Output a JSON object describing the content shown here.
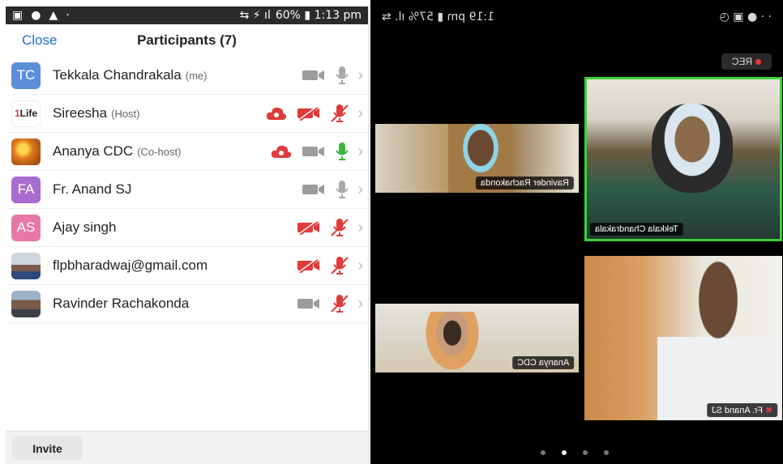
{
  "left_status": {
    "right_text": "60% ▮ 1:13 pm"
  },
  "header": {
    "close": "Close",
    "title": "Participants (7)"
  },
  "participants": [
    {
      "name": "Tekkala Chandrakala",
      "role": "(me)",
      "avatar": "TC",
      "avatar_color": "#5d8ed8"
    },
    {
      "name": "Sireesha",
      "role": "(Host)",
      "avatar": "1Life",
      "avatar_color": "#ffffff"
    },
    {
      "name": "Ananya CDC",
      "role": "(Co-host)",
      "avatar": "",
      "avatar_color": "#e07a1f"
    },
    {
      "name": "Fr. Anand SJ",
      "role": "",
      "avatar": "FA",
      "avatar_color": "#a86bd0"
    },
    {
      "name": "Ajay singh",
      "role": "",
      "avatar": "AS",
      "avatar_color": "#e877a6"
    },
    {
      "name": "flpbharadwaj@gmail.com",
      "role": "",
      "avatar": "",
      "avatar_color": "#7a5b4a"
    },
    {
      "name": "Ravinder Rachakonda",
      "role": "",
      "avatar": "",
      "avatar_color": "#556b8a"
    }
  ],
  "footer": {
    "invite": "Invite"
  },
  "right_status": {
    "left_text": "1:19 pm ▮ 57% ıl. ⇆",
    "right_text": "· · ● ▣ ◷"
  },
  "rec_label": "REC",
  "tiles": [
    {
      "name": "Ravinder Rachakonda"
    },
    {
      "name": "Tekkala Chandrakala"
    },
    {
      "name": "Ananya CDC"
    },
    {
      "name": "Fr. Anand SJ"
    }
  ],
  "colors": {
    "accent": "#1f6fd0",
    "red": "#e03a3a",
    "green": "#3fb33f",
    "active_speaker": "#3bd13b"
  }
}
